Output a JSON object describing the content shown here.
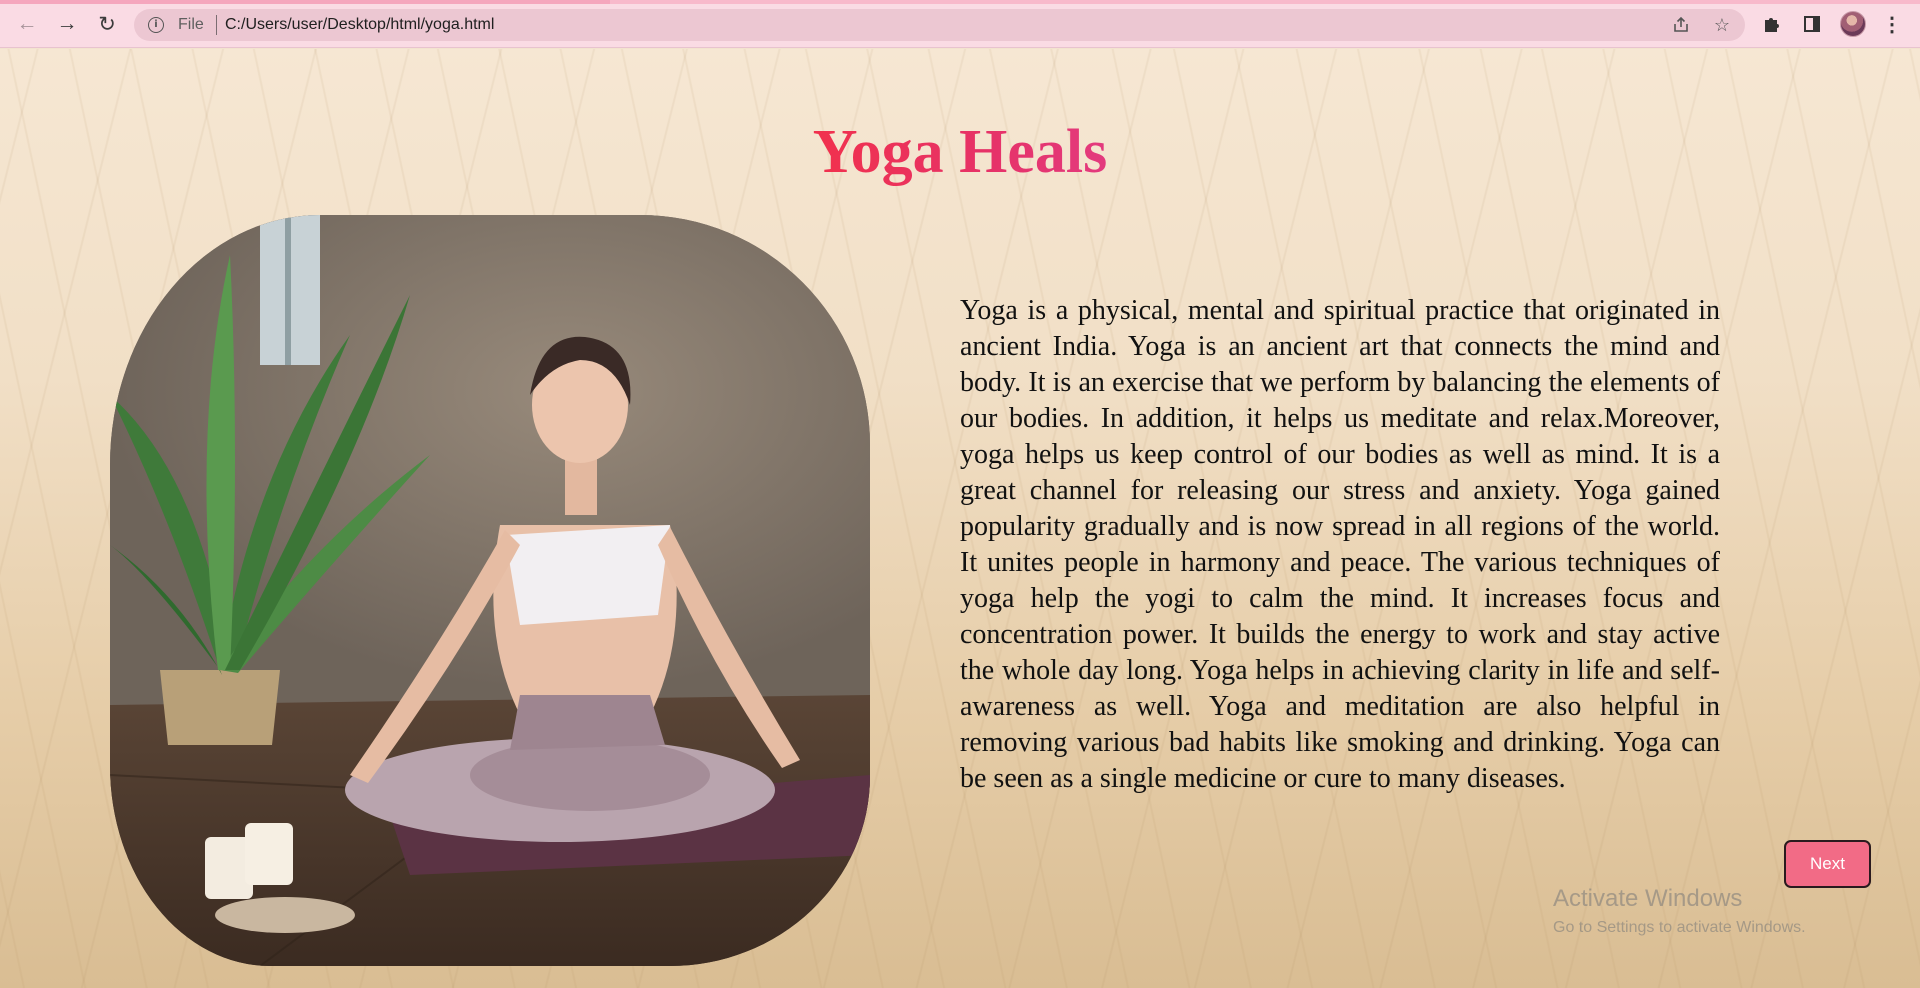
{
  "browser": {
    "scheme_label": "File",
    "url": "C:/Users/user/Desktop/html/yoga.html",
    "icons": {
      "back": "arrow-left-icon",
      "forward": "arrow-right-icon",
      "reload": "reload-icon",
      "info": "info-icon",
      "share": "share-icon",
      "bookmark": "star-icon",
      "extensions": "puzzle-icon",
      "side_panel": "side-panel-icon",
      "profile": "avatar-icon",
      "menu": "kebab-menu-icon"
    }
  },
  "page": {
    "title": "Yoga Heals",
    "paragraph": "Yoga is a physical, mental and spiritual practice that originated in ancient India. Yoga is an ancient art that connects the mind and body. It is an exercise that we perform by balancing the elements of our bodies. In addition, it helps us meditate and relax.Moreover, yoga helps us keep control of our bodies as well as mind. It is a great channel for releasing our stress and anxiety. Yoga gained popularity gradually and is now spread in all regions of the world. It unites people in harmony and peace. The various techniques of yoga help the yogi to calm the mind. It increases focus and concentration power. It builds the energy to work and stay active the whole day long. Yoga helps in achieving clarity in life and self-awareness as well. Yoga and meditation are also helpful in removing various bad habits like smoking and drinking. Yoga can be seen as a single medicine or cure to many diseases.",
    "next_button": "Next",
    "image": "woman-meditating-photo"
  },
  "watermark": {
    "line1": "Activate Windows",
    "line2": "Go to Settings to activate Windows."
  },
  "colors": {
    "title_gradient_start": "#f1314d",
    "title_gradient_end": "#e33a7e",
    "button_bg": "#f26b86",
    "browser_bar": "#fadbe4"
  }
}
